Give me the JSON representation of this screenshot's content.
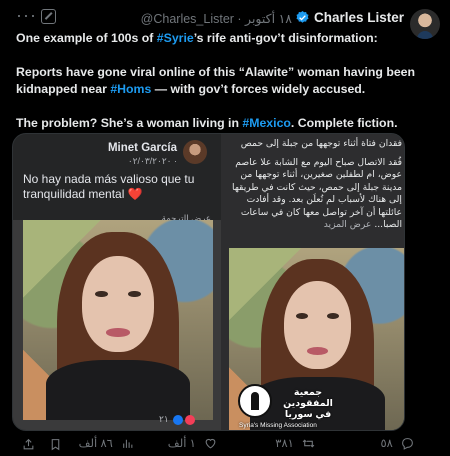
{
  "header": {
    "author_name": "Charles Lister",
    "handle_time": "@Charles_Lister · ١٨ أكتوبر",
    "more_glyph": "···"
  },
  "tweet": {
    "para1_pre": "One example of 100s of ",
    "para1_tag": "#Syrie",
    "para1_post": "’s rife anti-gov’t disinformation:",
    "para2_pre": "Reports have gone viral online of this “Alawite” woman having been kidnapped near ",
    "para2_tag": "#Homs",
    "para2_post": " — with gov’t forces widely accused.",
    "para3_pre": "The problem? She’s a woman living in ",
    "para3_tag": "#Mexico",
    "para3_post": ". Complete fiction."
  },
  "facebook_post": {
    "name": "Minet García",
    "date": "٠٢/٠٣/٢٠٢٠ ·",
    "text": "No hay nada más valioso que tu tranquilidad mental",
    "heart": "❤️",
    "translate": "عرض الترجمة",
    "reactions_count": "٢١"
  },
  "arabic_post": {
    "line1": "فقدان فتاة أثناء توجهها من جبلة إلى حمص",
    "body": "فُقد الاتصال صباح اليوم مع الشابة علا عاصم عوض، ام لطفلين صغيرين، أثناء توجهها من مدينة جبلة إلى حمص، حيث كانت في طريقها إلى هناك لأسباب لم تُعلَن بعد. وقد أفادت عائلتها أن آخر تواصل معها كان في ساعات الصبا...",
    "more": "عرض المزيد",
    "logo_title": "جمعية المفقودين في سوريا",
    "logo_subtitle": "Syria's Missing Association"
  },
  "actions": {
    "replies": "٥٨",
    "retweets": "٣٨١",
    "likes": "١ ألف",
    "views": "٨٦ ألف"
  },
  "colors": {
    "background": "#000000",
    "text": "#e7e9ea",
    "muted": "#71767b",
    "link": "#1d9bf0",
    "verified": "#1d9bf0"
  }
}
